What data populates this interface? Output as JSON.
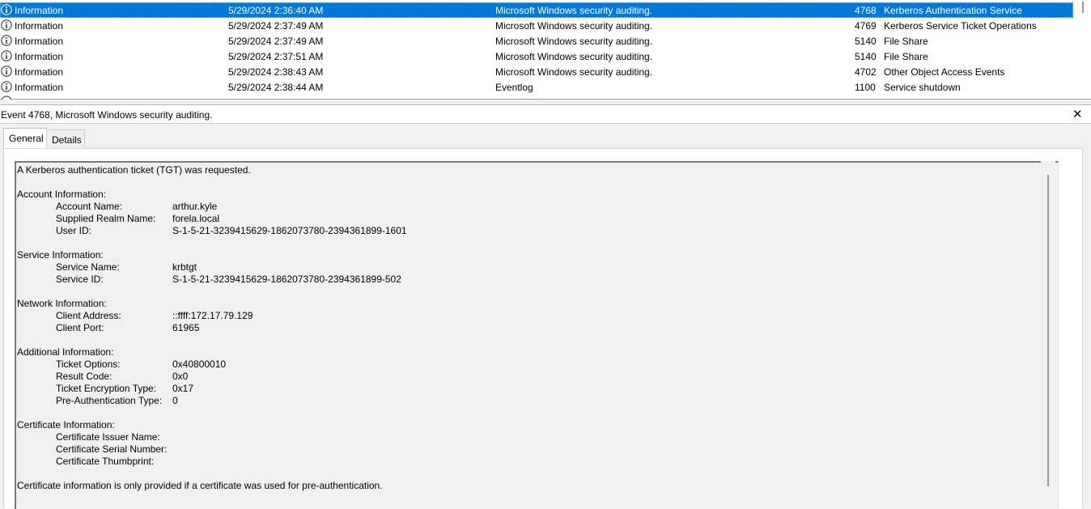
{
  "events": [
    {
      "level": "Information",
      "date": "5/29/2024 2:36:40 AM",
      "source": "Microsoft Windows security auditing.",
      "event_id": "4768",
      "task": "Kerberos Authentication Service",
      "selected": true
    },
    {
      "level": "Information",
      "date": "5/29/2024 2:37:49 AM",
      "source": "Microsoft Windows security auditing.",
      "event_id": "4769",
      "task": "Kerberos Service Ticket Operations"
    },
    {
      "level": "Information",
      "date": "5/29/2024 2:37:49 AM",
      "source": "Microsoft Windows security auditing.",
      "event_id": "5140",
      "task": "File Share"
    },
    {
      "level": "Information",
      "date": "5/29/2024 2:37:51 AM",
      "source": "Microsoft Windows security auditing.",
      "event_id": "5140",
      "task": "File Share"
    },
    {
      "level": "Information",
      "date": "5/29/2024 2:38:43 AM",
      "source": "Microsoft Windows security auditing.",
      "event_id": "4702",
      "task": "Other Object Access Events"
    },
    {
      "level": "Information",
      "date": "5/29/2024 2:38:44 AM",
      "source": "Eventlog",
      "event_id": "1100",
      "task": "Service shutdown"
    }
  ],
  "level_icon": "information-icon",
  "colors": {
    "selection": "#0078d7",
    "info_icon": "#1a5fb4"
  },
  "detail": {
    "header_title": "Event 4768, Microsoft Windows security auditing.",
    "close_glyph": "✕",
    "tabs": [
      "General",
      "Details"
    ],
    "summary": "A Kerberos authentication ticket (TGT) was requested.",
    "sections": {
      "account": {
        "title": "Account Information:",
        "account_name_label": "Account Name:",
        "account_name": "arthur.kyle",
        "realm_label": "Supplied Realm Name:",
        "realm": "forela.local",
        "user_id_label": "User ID:",
        "user_id": "S-1-5-21-3239415629-1862073780-2394361899-1601"
      },
      "service": {
        "title": "Service Information:",
        "service_name_label": "Service Name:",
        "service_name": "krbtgt",
        "service_id_label": "Service ID:",
        "service_id": "S-1-5-21-3239415629-1862073780-2394361899-502"
      },
      "network": {
        "title": "Network Information:",
        "client_address_label": "Client Address:",
        "client_address": "::ffff:172.17.79.129",
        "client_port_label": "Client Port:",
        "client_port": "61965"
      },
      "additional": {
        "title": "Additional Information:",
        "ticket_options_label": "Ticket Options:",
        "ticket_options": "0x40800010",
        "result_code_label": "Result Code:",
        "result_code": "0x0",
        "encryption_label": "Ticket Encryption Type:",
        "encryption": "0x17",
        "preauth_label": "Pre-Authentication Type:",
        "preauth": "0"
      },
      "certificate": {
        "title": "Certificate Information:",
        "issuer_label": "Certificate Issuer Name:",
        "serial_label": "Certificate Serial Number:",
        "thumbprint_label": "Certificate Thumbprint:"
      }
    },
    "footer_note": "Certificate information is only provided if a certificate was used for pre-authentication."
  }
}
